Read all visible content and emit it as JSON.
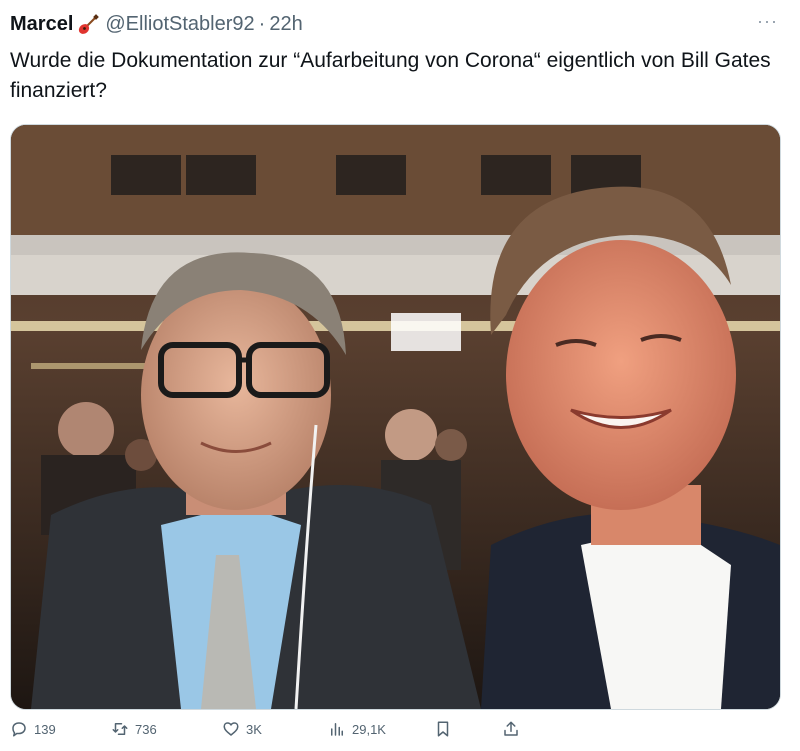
{
  "tweet": {
    "display_name": "Marcel",
    "name_emoji": "guitar-icon",
    "handle": "@ElliotStabler92",
    "separator": "·",
    "time": "22h",
    "more_icon": "more-dots-icon",
    "text": "Wurde die Dokumentation zur “Aufarbeitung von Corona“ eigentlich von Bill Gates finanziert?",
    "media": {
      "description_icon": "photo-image"
    },
    "actions": {
      "reply_count": "139",
      "retweet_count": "736",
      "like_count": "3K",
      "views_count": "29,1K"
    }
  },
  "colors": {
    "text_primary": "#0f1419",
    "text_secondary": "#536471",
    "border": "#cfd9de"
  }
}
